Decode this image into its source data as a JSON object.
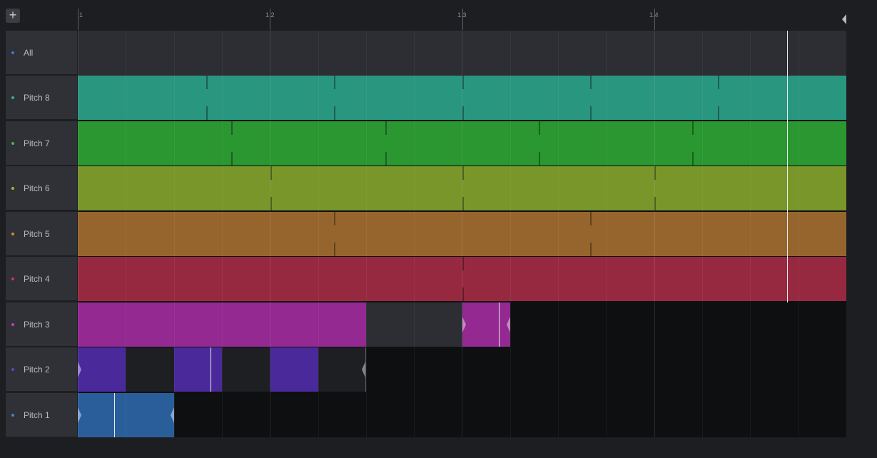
{
  "toolbar": {
    "add_label": "+"
  },
  "ruler": {
    "ticks": [
      "1",
      "1.2",
      "1.3",
      "1.4"
    ]
  },
  "tracks": [
    {
      "name": "All",
      "color": "#3a7bd5"
    },
    {
      "name": "Pitch 8",
      "color": "#2ab49a"
    },
    {
      "name": "Pitch 7",
      "color": "#3cc03c"
    },
    {
      "name": "Pitch 6",
      "color": "#9fbf2e"
    },
    {
      "name": "Pitch 5",
      "color": "#d38a2e"
    },
    {
      "name": "Pitch 4",
      "color": "#d63552"
    },
    {
      "name": "Pitch 3",
      "color": "#c83acb"
    },
    {
      "name": "Pitch 2",
      "color": "#6a3ad0"
    },
    {
      "name": "Pitch 1",
      "color": "#3a86d5"
    }
  ],
  "colors": {
    "pitch8": "#29967f",
    "pitch7": "#2a9731",
    "pitch6": "#78962a",
    "pitch5": "#96652e",
    "pitch4": "#962940",
    "pitch3": "#932991",
    "pitch2": "#4a2a9a",
    "pitch1": "#2a5e9a",
    "all_lane": "#2c2e33"
  }
}
